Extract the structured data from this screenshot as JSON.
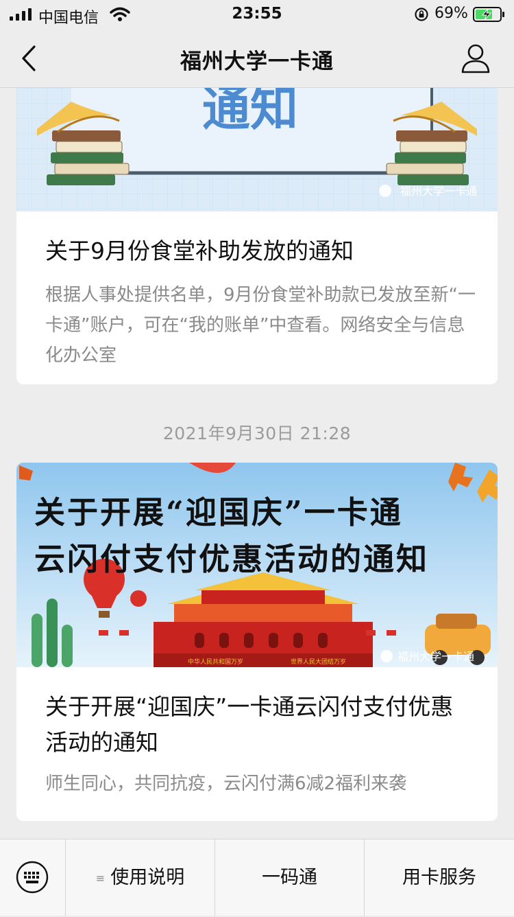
{
  "status_bar": {
    "carrier": "中国电信",
    "time": "23:55",
    "battery": "69%"
  },
  "nav": {
    "title": "福州大学一卡通"
  },
  "feed": {
    "articles": [
      {
        "cover_text": "通知",
        "watermark": "福州大学一卡通",
        "title": "关于9月份食堂补助发放的通知",
        "desc": "根据人事处提供名单，9月份食堂补助款已发放至新“一卡通”账户，可在“我的账单”中查看。网络安全与信息化办公室"
      },
      {
        "banner_line1": "关于开展“迎国庆”一卡通",
        "banner_line2": "云闪付支付优惠活动的通知",
        "watermark": "福州大学一卡通",
        "gate_left_text": "中华人民共和国万岁",
        "gate_right_text": "世界人民大团结万岁",
        "title": "关于开展“迎国庆”一卡通云闪付支付优惠活动的通知",
        "desc": "师生同心，共同抗疫，云闪付满6减2福利来袭"
      }
    ],
    "timestamp": "2021年9月30日 21:28"
  },
  "bottom_menu": {
    "items": [
      "使用说明",
      "一码通",
      "用卡服务"
    ],
    "submenu_icon": "≡"
  },
  "colors": {
    "background": "#ededed",
    "card": "#ffffff",
    "secondary_text": "#8a8a8a",
    "sky_blue": "#a9d3f0",
    "gate_red": "#c8231e"
  }
}
